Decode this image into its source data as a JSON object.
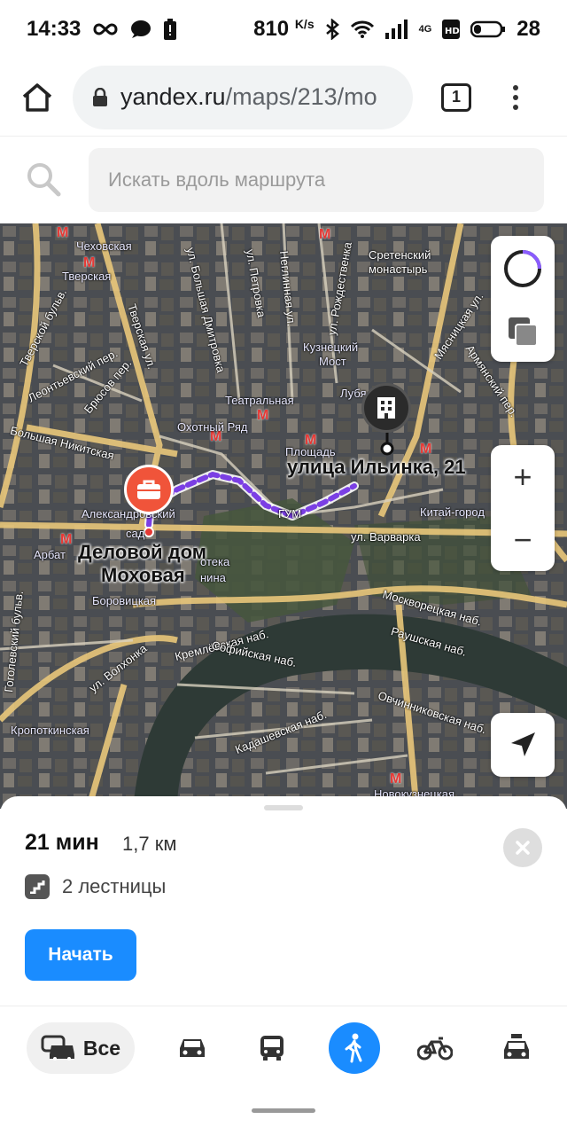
{
  "status_bar": {
    "time": "14:33",
    "net_speed": "810",
    "net_unit": "K/s",
    "network": "4G",
    "battery": "28"
  },
  "browser": {
    "url_host": "yandex.ru",
    "url_path": "/maps/213/mo",
    "tab_count": "1"
  },
  "route_search": {
    "placeholder": "Искать вдоль маршрута"
  },
  "map": {
    "start_label": "Деловой дом\nМоховая",
    "start_label_line1": "Деловой дом",
    "start_label_line2": "Моховая",
    "end_label": "улица Ильинка, 21",
    "labels": {
      "chekhovskaya": "Чеховская",
      "tverskaya": "Тверская",
      "sretensky": "Сретенский\nмонастырь",
      "sretensky1": "Сретенский",
      "sretensky2": "монастырь",
      "kuznetsky1": "Кузнецкий",
      "kuznetsky2": "Мост",
      "lubyanka": "Лубя",
      "teatralnaya": "Театральная",
      "okhotny": "Охотный Ряд",
      "ploshchad": "Площадь",
      "gum": "ГУМ",
      "kitay_gorod": "Китай-город",
      "aleksandrovsky1": "Александровский",
      "aleksandrovsky2": "сад",
      "arbat": "Арбат",
      "borovitskaya": "Боровицкая",
      "biblioteka": "отека",
      "lenina": "нина",
      "varvarka": "ул. Варварка",
      "moskvoretskaya": "Москворецкая наб.",
      "raushskaya": "Раушская наб.",
      "kremlevskaya": "Кремлёвская наб.",
      "sofiyskaya": "Софийская наб.",
      "ovchinnikovskaya": "Овчинниковская наб.",
      "kadashevskaya": "Кадашевская наб.",
      "volkhonka": "ул. Волхонка",
      "kropotkinskaya": "Кропоткинская",
      "novokuznetskaya": "Новокузнецкая",
      "tverskoy_bulv": "Тверской бульв.",
      "bolshaya_nikitskaya": "Большая Никитская",
      "tverskaya_ul": "Тверская ул.",
      "petrovka": "ул. Петровка",
      "neglinnaya": "Неглинная ул.",
      "rozhdestvenka": "ул. Рождественка",
      "b_dmitrovka": "ул. Большая Дмитровка",
      "myasnitskaya": "Мясницкая ул.",
      "armyansky": "Армянский пер.",
      "gogolevsky": "Гоголевский бульв.",
      "bryusov": "Брюсов пер.",
      "leontyevsky": "Леонтьевский пер."
    }
  },
  "route_summary": {
    "time": "21 мин",
    "distance": "1,7 км",
    "stairs": "2 лестницы",
    "start_button": "Начать"
  },
  "modes": {
    "all_label": "Все"
  },
  "colors": {
    "accent": "#1a8cff",
    "route": "#7b3fe4",
    "start_pin": "#f0543a",
    "metro": "#e53935"
  }
}
